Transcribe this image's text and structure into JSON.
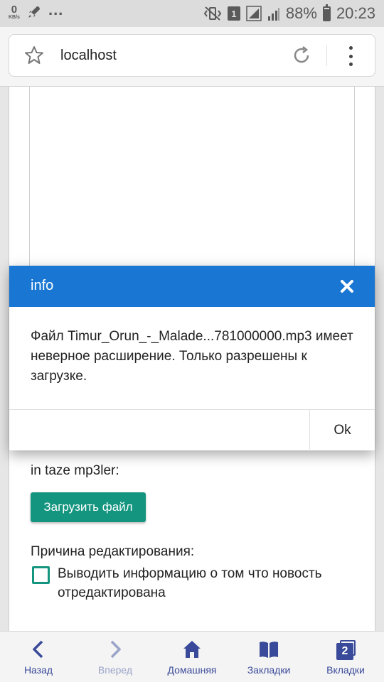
{
  "status_bar": {
    "net_speed_value": "0",
    "net_speed_unit": "KB/s",
    "overflow": "...",
    "sim_number": "1",
    "battery_percent": "88%",
    "battery_level": 0.88,
    "time": "20:23"
  },
  "browser": {
    "url": "localhost"
  },
  "page": {
    "upload_field_label": "in taze mp3ler:",
    "upload_button_label": "Загрузить файл",
    "reason_label": "Причина редактирования:",
    "checkbox_label": "Выводить информацию о том что новость отредактирована"
  },
  "modal": {
    "title": "info",
    "message": "Файл Timur_Orun_-_Malade...781000000.mp3 имеет неверное расширение. Только разрешены к загрузке.",
    "ok_label": "Ok"
  },
  "bottom_nav": [
    {
      "label": "Назад",
      "icon": "chevron-left-icon"
    },
    {
      "label": "Вперед",
      "icon": "chevron-right-icon"
    },
    {
      "label": "Домашняя",
      "icon": "home-icon"
    },
    {
      "label": "Закладки",
      "icon": "bookmarks-icon"
    },
    {
      "label": "Вкладки",
      "icon": "tabs-icon",
      "badge": "2"
    }
  ],
  "colors": {
    "modal_header": "#1976d2",
    "accent_teal": "#14957f",
    "nav_icon": "#3a4a9a"
  }
}
